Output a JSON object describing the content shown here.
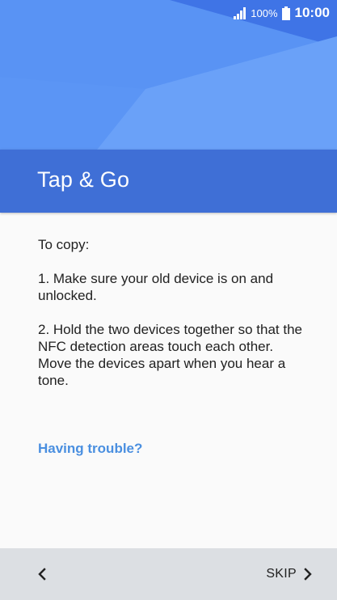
{
  "status_bar": {
    "battery_percent": "100%",
    "time": "10:00",
    "icons": [
      "signal-icon",
      "battery-icon"
    ]
  },
  "header": {
    "title": "Tap & Go",
    "colors": {
      "hero": "#5e97f6",
      "title_band": "#3f6fd6"
    }
  },
  "content": {
    "intro": "To copy:",
    "step1": "1. Make sure your old device is on and unlocked.",
    "step2": "2. Hold the two devices together so that the NFC detection areas touch each other. Move the devices apart when you hear a tone.",
    "trouble_link": "Having trouble?",
    "link_color": "#4a8fe0"
  },
  "bottom_bar": {
    "back_icon": "chevron-left-icon",
    "skip_label": "SKIP",
    "skip_icon": "chevron-right-icon"
  }
}
